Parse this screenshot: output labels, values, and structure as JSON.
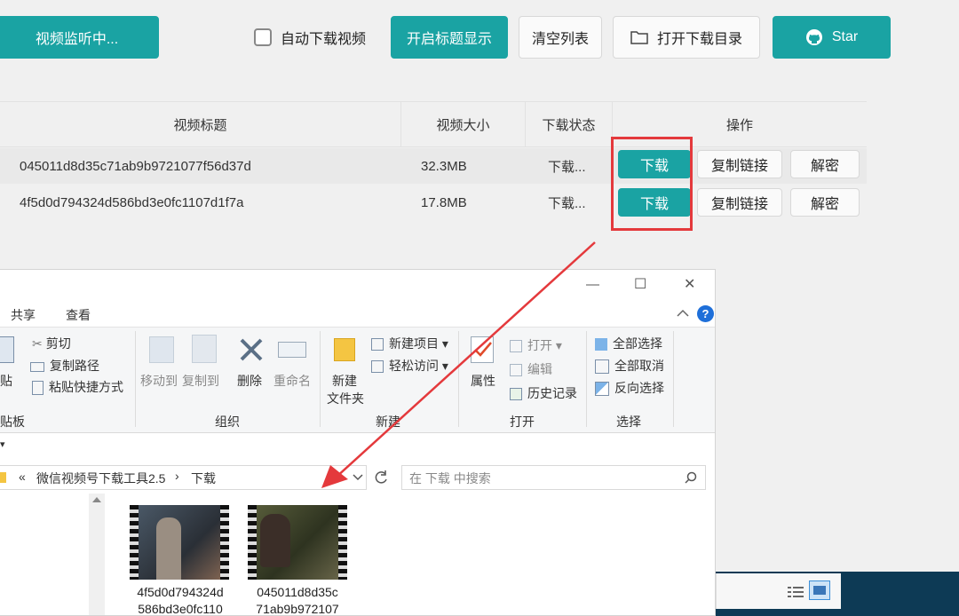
{
  "toolbar": {
    "monitor_label": "视频监听中...",
    "auto_download_label": "自动下载视频",
    "show_title_label": "开启标题显示",
    "clear_list_label": "清空列表",
    "open_dir_label": "打开下载目录",
    "star_label": "Star"
  },
  "table": {
    "columns": [
      "视频标题",
      "视频大小",
      "下载状态",
      "操作"
    ],
    "rows": [
      {
        "title": "045011d8d35c71ab9b9721077f56d37d",
        "size": "32.3MB",
        "status": "下载...",
        "download": "下载",
        "copy": "复制链接",
        "decrypt": "解密"
      },
      {
        "title": "4f5d0d794324d586bd3e0fc1107d1f7a",
        "size": "17.8MB",
        "status": "下载...",
        "download": "下载",
        "copy": "复制链接",
        "decrypt": "解密"
      }
    ]
  },
  "explorer": {
    "tabs": [
      "共享",
      "查看"
    ],
    "clipboard": {
      "paste": "粘贴",
      "cut": "剪切",
      "copy_path": "复制路径",
      "paste_shortcut": "粘贴快捷方式",
      "group": "剪贴板"
    },
    "organize": {
      "move_to": "移动到",
      "copy_to": "复制到",
      "delete": "删除",
      "rename": "重命名",
      "group": "组织"
    },
    "new": {
      "new_folder_1": "新建",
      "new_folder_2": "文件夹",
      "new_item": "新建项目",
      "easy_access": "轻松访问",
      "group": "新建"
    },
    "open": {
      "properties": "属性",
      "open": "打开",
      "edit": "编辑",
      "history": "历史记录",
      "group": "打开"
    },
    "select": {
      "select_all": "全部选择",
      "select_none": "全部取消",
      "invert": "反向选择",
      "group": "选择"
    },
    "breadcrumb": {
      "sep": "«",
      "folder": "微信视频号下载工具2.5",
      "arrow": "›",
      "current": "下载"
    },
    "search_placeholder": "在 下载 中搜索",
    "files": [
      {
        "line1": "4f5d0d794324d",
        "line2": "586bd3e0fc110"
      },
      {
        "line1": "045011d8d35c",
        "line2": "71ab9b972107"
      }
    ],
    "window_buttons": {
      "minimize": "—",
      "maximize": "☐",
      "close": "✕"
    }
  },
  "colors": {
    "accent": "#1aa3a3",
    "highlight": "#e4393c",
    "help": "#1e6fd9"
  }
}
